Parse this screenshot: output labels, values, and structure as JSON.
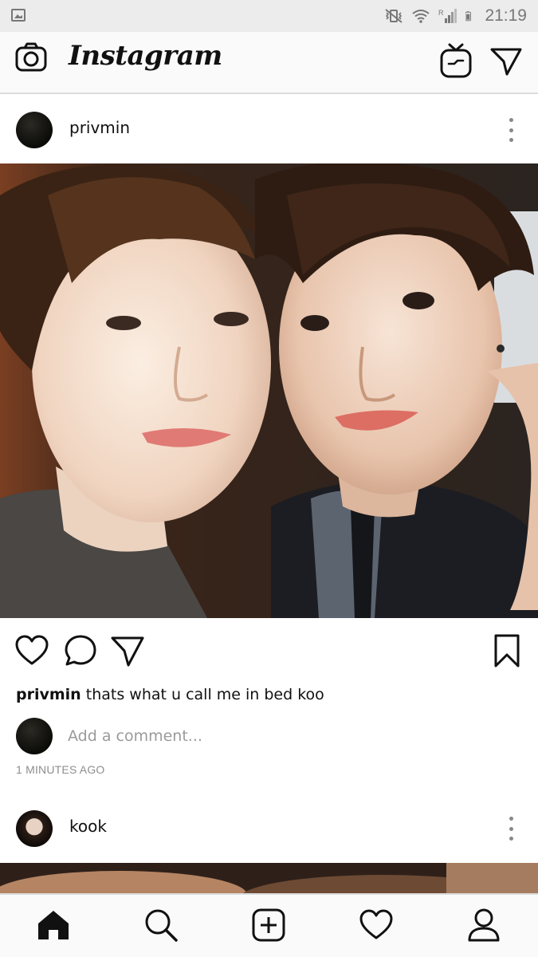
{
  "status_bar": {
    "time": "21:19",
    "icons": [
      "gallery-icon",
      "vibrate-mute-icon",
      "wifi-icon",
      "signal-roaming-icon",
      "battery-icon"
    ]
  },
  "app_bar": {
    "title": "Instagram",
    "icons": [
      "camera-icon",
      "igtv-icon",
      "direct-message-icon"
    ]
  },
  "feed": {
    "post1": {
      "username": "privmin",
      "caption_user": "privmin",
      "caption_text": " thats what u call me in bed koo",
      "comment_placeholder": "Add a comment...",
      "timestamp": "1 MINUTES AGO",
      "actions": [
        "heart-icon",
        "comment-icon",
        "share-icon",
        "bookmark-icon"
      ]
    },
    "post2": {
      "username": "kook"
    }
  },
  "bottom_nav": {
    "items": [
      "home-icon",
      "search-icon",
      "new-post-icon",
      "activity-heart-icon",
      "profile-icon"
    ]
  },
  "colors": {
    "text": "#111111",
    "muted": "#8e8e8e",
    "divider": "#dcdcdc",
    "status_bar_bg": "#ececec",
    "bar_bg": "#fafafa"
  }
}
